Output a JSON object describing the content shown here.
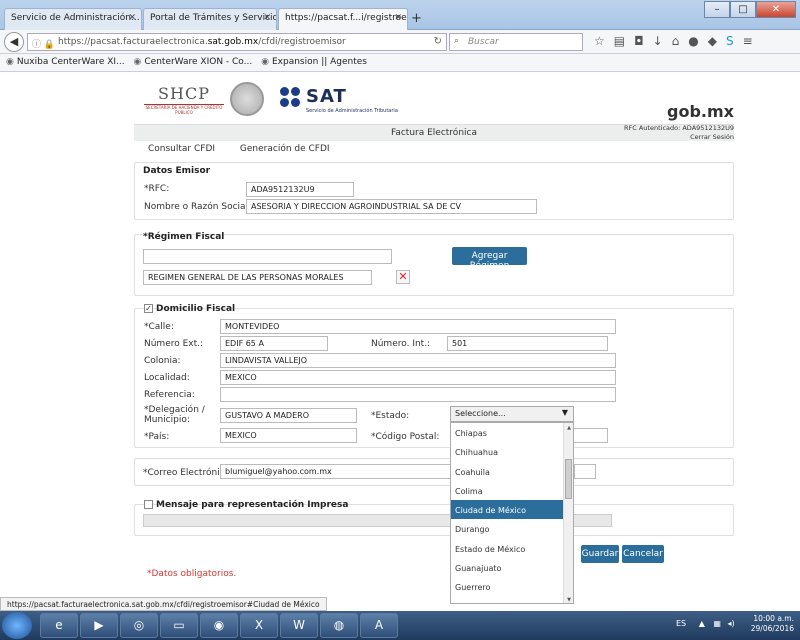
{
  "browser": {
    "tabs": [
      {
        "label": "Servicio de Administración..."
      },
      {
        "label": "Portal de Trámites y Servicios a..."
      },
      {
        "label": "https://pacsat.f...i/registroemisor"
      }
    ],
    "url_prefix": "https://pacsat.facturaelectronica.",
    "url_domain": "sat.gob.mx",
    "url_suffix": "/cfdi/registroemisor",
    "search_placeholder": "Buscar",
    "bookmarks": [
      "Nuxiba CenterWare XI...",
      "CenterWare XION - Co...",
      "Expansion || Agentes"
    ]
  },
  "header": {
    "shcp": "SHCP",
    "shcp_sub": "SECRETARÍA DE HACIENDA Y CRÉDITO PÚBLICO",
    "sat": "SAT",
    "sat_sub": "Servicio de Administración Tributaria",
    "gobmx": "gob.mx",
    "rfc_auth": "RFC Autenticado: ADA9512132U9",
    "logout": "Cerrar Sesión",
    "band_title": "Factura Electrónica"
  },
  "menu": [
    "Consultar CFDI",
    "Generación de CFDI"
  ],
  "emisor": {
    "title": "Datos Emisor",
    "rfc_label": "*RFC:",
    "rfc_value": "ADA9512132U9",
    "razon_label": "Nombre o Razón Social:",
    "razon_value": "ASESORIA Y DIRECCION AGROINDUSTRIAL SA DE CV"
  },
  "regimen": {
    "title": "*Régimen Fiscal",
    "add_button": "Agregar Régimen",
    "item": "REGIMEN GENERAL DE LAS PERSONAS MORALES",
    "remove_glyph": "✕"
  },
  "domicilio": {
    "title": "Domicilio Fiscal",
    "check_glyph": "✓",
    "calle_label": "*Calle:",
    "calle_value": "MONTEVIDEO",
    "num_ext_label": "Número Ext.:",
    "num_ext_value": "EDIF 65 A",
    "num_int_label": "Número. Int.:",
    "num_int_value": "501",
    "colonia_label": "Colonia:",
    "colonia_value": "LINDAVISTA VALLEJO",
    "localidad_label": "Localidad:",
    "localidad_value": "MEXICO",
    "referencia_label": "Referencia:",
    "delegacion_label_1": "*Delegación /",
    "delegacion_label_2": "Municipio:",
    "delegacion_value": "GUSTAVO A MADERO",
    "estado_label": "*Estado:",
    "estado_selected": "Seleccione...",
    "pais_label": "*País:",
    "pais_value": "MEXICO",
    "cp_label": "*Código Postal:"
  },
  "estado_options": [
    "Chiapas",
    "Chihuahua",
    "Coahuila",
    "Colima",
    "Ciudad de México",
    "Durango",
    "Estado de México",
    "Guanajuato",
    "Guerrero"
  ],
  "estado_selected_index": 4,
  "correo": {
    "label": "*Correo Electrónico",
    "value": "blumiguel@yahoo.com.mx"
  },
  "mensaje": {
    "title": "Mensaje para representación Impresa"
  },
  "actions": {
    "save": "Guardar",
    "cancel": "Cancelar"
  },
  "required_note": "*Datos obligatorios.",
  "status_url": "https://pacsat.facturaelectronica.sat.gob.mx/cfdi/registroemisor#Ciudad de México",
  "taskbar": {
    "lang": "ES",
    "time": "10:00 a.m.",
    "date": "29/06/2016"
  }
}
